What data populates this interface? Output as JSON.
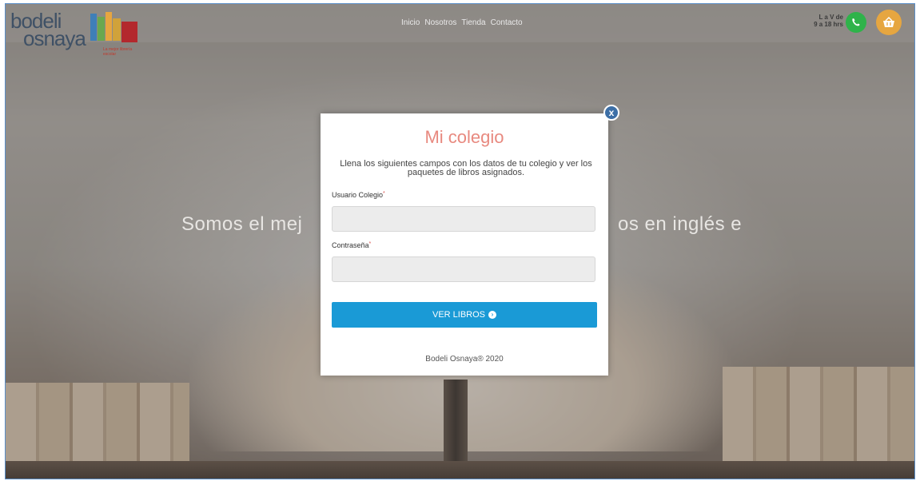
{
  "header": {
    "logo": {
      "line1": "bodeli",
      "line2": "osnaya",
      "tagline": "La mejor librería escolar"
    },
    "nav": [
      "Inicio",
      "Nosotros",
      "Tienda",
      "Contacto"
    ],
    "hours": {
      "line1": "L a V de",
      "line2": "9 a 18 hrs"
    },
    "whatsapp_icon": "whatsapp-icon",
    "cart_icon": "shopping-basket-icon",
    "colors": {
      "whatsapp": "#2fb34a",
      "cart": "#e6a640"
    }
  },
  "hero": {
    "left": "Somos el mej",
    "right": "os en inglés e"
  },
  "modal": {
    "title": "Mi colegio",
    "description": "Llena los siguientes campos con los datos de tu colegio y ver los paquetes de libros asignados.",
    "username_label": "Usuario Colegio",
    "username_value": "",
    "password_label": "Contraseña",
    "password_value": "",
    "required_mark": "*",
    "submit_label": "VER LIBROS",
    "footer": "Bodeli Osnaya® 2020",
    "close_label": "x",
    "colors": {
      "title": "#e8897f",
      "button": "#1a9ad6",
      "close": "#3d6fa6"
    }
  }
}
